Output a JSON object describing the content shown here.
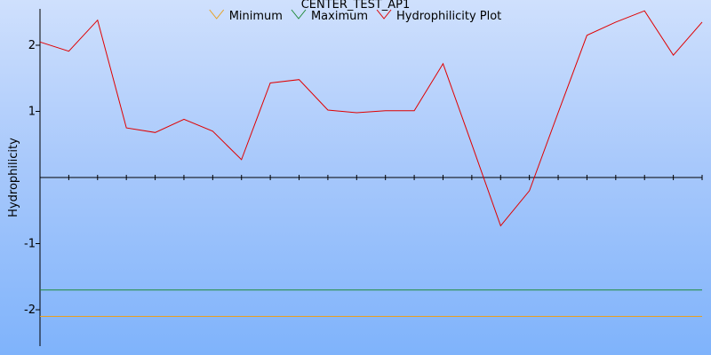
{
  "chart_data": {
    "type": "line",
    "title": "CENTER_TEST_AP1",
    "ylabel": "Hydrophilicity",
    "xlabel": "",
    "ylim": [
      -2.55,
      2.55
    ],
    "xlim": [
      0,
      23
    ],
    "yticks": [
      {
        "value": 2,
        "label": "2"
      },
      {
        "value": 1,
        "label": "1"
      },
      {
        "value": -1,
        "label": "-1"
      },
      {
        "value": -2,
        "label": "-2"
      }
    ],
    "grid": false,
    "legend_position": "top",
    "series": [
      {
        "name": "Minimum",
        "color": "#e8a020",
        "x": [
          0,
          23
        ],
        "values": [
          -2.1,
          -2.1
        ]
      },
      {
        "name": "Maximum",
        "color": "#1f8a3a",
        "x": [
          0,
          23
        ],
        "values": [
          -1.7,
          -1.7
        ]
      },
      {
        "name": "Hydrophilicity Plot",
        "color": "#e00000",
        "x": [
          0,
          1,
          2,
          3,
          4,
          5,
          6,
          7,
          8,
          9,
          10,
          11,
          12,
          13,
          14,
          15,
          16,
          17,
          18,
          19,
          20,
          21,
          22,
          23
        ],
        "values": [
          2.05,
          1.91,
          2.38,
          0.75,
          0.68,
          0.88,
          0.7,
          0.27,
          1.43,
          1.48,
          1.02,
          0.98,
          1.01,
          1.01,
          1.72,
          0.5,
          -0.73,
          -0.2,
          0.98,
          2.15,
          2.35,
          2.52,
          1.85,
          2.35
        ]
      }
    ]
  }
}
